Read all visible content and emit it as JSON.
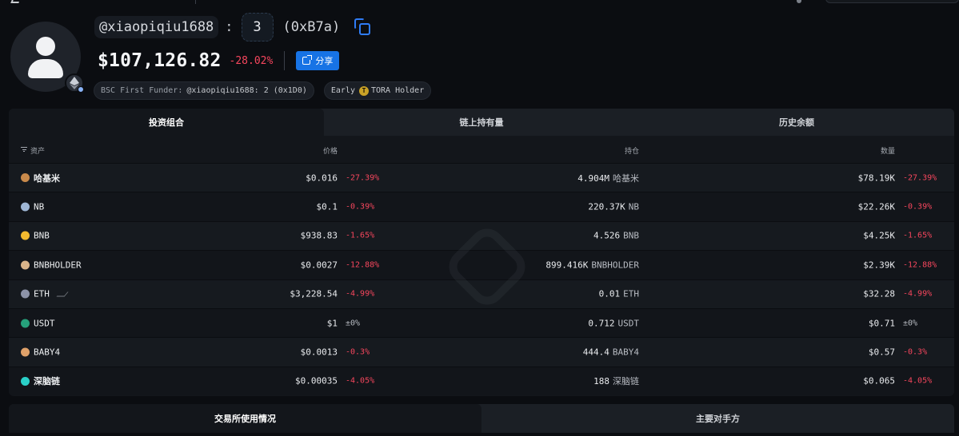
{
  "profile": {
    "handle": "@xiaopiqiu1688",
    "separator": ":",
    "count": "3",
    "address_short": "(0xB7a)",
    "total_value": "$107,126.82",
    "total_change": "-28.02%",
    "share_label": "分享",
    "tags": {
      "funder_label": "BSC First Funder:",
      "funder_value": "@xiaopiqiu1688: 2 (0x1D0)",
      "early_label": "Early",
      "early_token": "TORA Holder"
    }
  },
  "tabs": [
    "投资组合",
    "链上持有量",
    "历史余额"
  ],
  "columns": {
    "asset": "资产",
    "price": "价格",
    "holding": "持仓",
    "value": "数量"
  },
  "rows": [
    {
      "asset": "哈基米",
      "price": "$0.016",
      "price_change": "-27.39%",
      "holding": "4.904M",
      "unit": "哈基米",
      "value": "$78.19K",
      "value_change": "-27.39%",
      "icon_color": "#c98a4b",
      "cjk": true
    },
    {
      "asset": "NB",
      "price": "$0.1",
      "price_change": "-0.39%",
      "holding": "220.37K",
      "unit": "NB",
      "value": "$22.26K",
      "value_change": "-0.39%",
      "icon_color": "#9fb7d6",
      "cjk": false
    },
    {
      "asset": "BNB",
      "price": "$938.83",
      "price_change": "-1.65%",
      "holding": "4.526",
      "unit": "BNB",
      "value": "$4.25K",
      "value_change": "-1.65%",
      "icon_color": "#f3ba2f",
      "cjk": false
    },
    {
      "asset": "BNBHOLDER",
      "price": "$0.0027",
      "price_change": "-12.88%",
      "holding": "899.416K",
      "unit": "BNBHOLDER",
      "value": "$2.39K",
      "value_change": "-12.88%",
      "icon_color": "#d9b48a",
      "cjk": false
    },
    {
      "asset": "ETH",
      "price": "$3,228.54",
      "price_change": "-4.99%",
      "holding": "0.01",
      "unit": "ETH",
      "value": "$32.28",
      "value_change": "-4.99%",
      "icon_color": "#8c93a8",
      "cjk": false
    },
    {
      "asset": "USDT",
      "price": "$1",
      "price_change": "±0%",
      "holding": "0.712",
      "unit": "USDT",
      "value": "$0.71",
      "value_change": "±0%",
      "icon_color": "#26a17b",
      "cjk": false
    },
    {
      "asset": "BABY4",
      "price": "$0.0013",
      "price_change": "-0.3%",
      "holding": "444.4",
      "unit": "BABY4",
      "value": "$0.57",
      "value_change": "-0.3%",
      "icon_color": "#e0a26a",
      "cjk": false
    },
    {
      "asset": "深脑链",
      "price": "$0.00035",
      "price_change": "-4.05%",
      "holding": "188",
      "unit": "深脑链",
      "value": "$0.065",
      "value_change": "-4.05%",
      "icon_color": "#2ad0c8",
      "cjk": true
    }
  ],
  "bottom_tabs": [
    "交易所使用情况",
    "主要对手方"
  ],
  "colors": {
    "negative": "#f6465d",
    "accent": "#1773e5",
    "background": "#0b0d11"
  }
}
